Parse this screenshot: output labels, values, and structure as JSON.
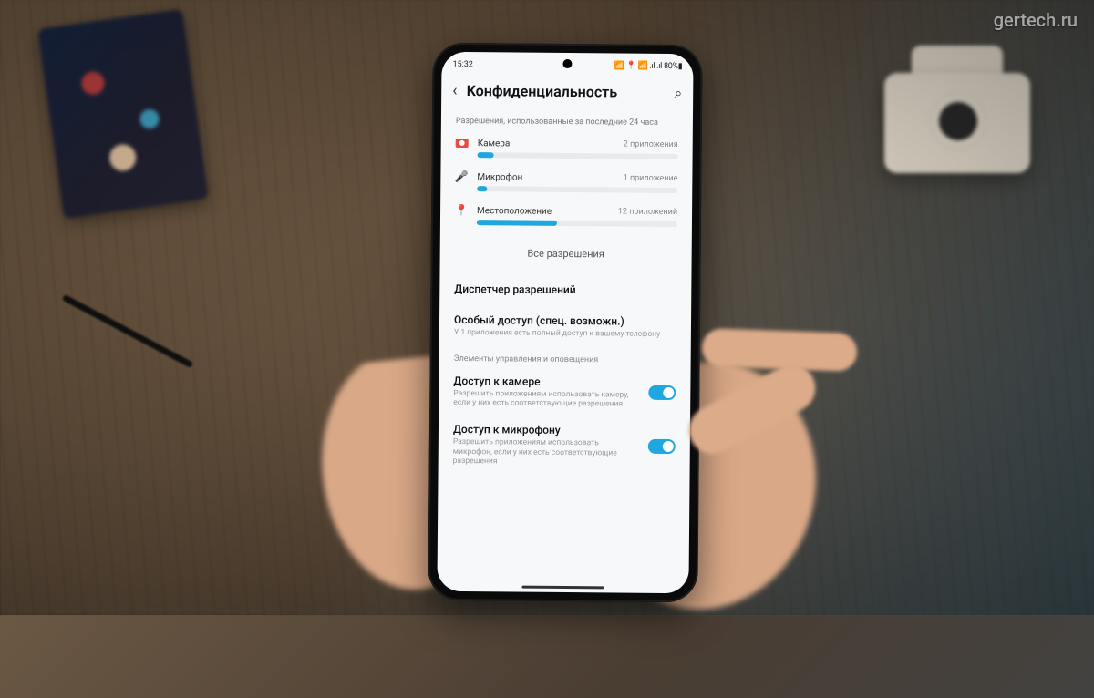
{
  "watermark": "gertech.ru",
  "status": {
    "time": "15:32",
    "right": "📶 📍 📶 .ıl .ıl 80%▮",
    "battery_percent": 80
  },
  "header": {
    "title": "Конфиденциальность"
  },
  "usage_section_label": "Разрешения, использованные за последние 24 часа",
  "permissions": [
    {
      "icon": "camera",
      "name": "Камера",
      "count_label": "2 приложения",
      "bar_percent": 8
    },
    {
      "icon": "mic",
      "name": "Микрофон",
      "count_label": "1 приложение",
      "bar_percent": 5
    },
    {
      "icon": "location",
      "name": "Местоположение",
      "count_label": "12 приложений",
      "bar_percent": 40
    }
  ],
  "all_permissions_label": "Все разрешения",
  "items": {
    "dispatcher": {
      "title": "Диспетчер разрешений"
    },
    "special_access": {
      "title": "Особый доступ (спец. возможн.)",
      "desc": "У 1 приложения есть полный доступ к вашему телефону"
    }
  },
  "controls_section_label": "Элементы управления и оповещения",
  "toggles": {
    "camera": {
      "title": "Доступ к камере",
      "desc": "Разрешить приложениям использовать камеру, если у них есть соответствующие разрешения",
      "on": true
    },
    "mic": {
      "title": "Доступ к микрофону",
      "desc": "Разрешить приложениям использовать микрофон, если у них есть соответствующие разрешения",
      "on": true
    }
  }
}
